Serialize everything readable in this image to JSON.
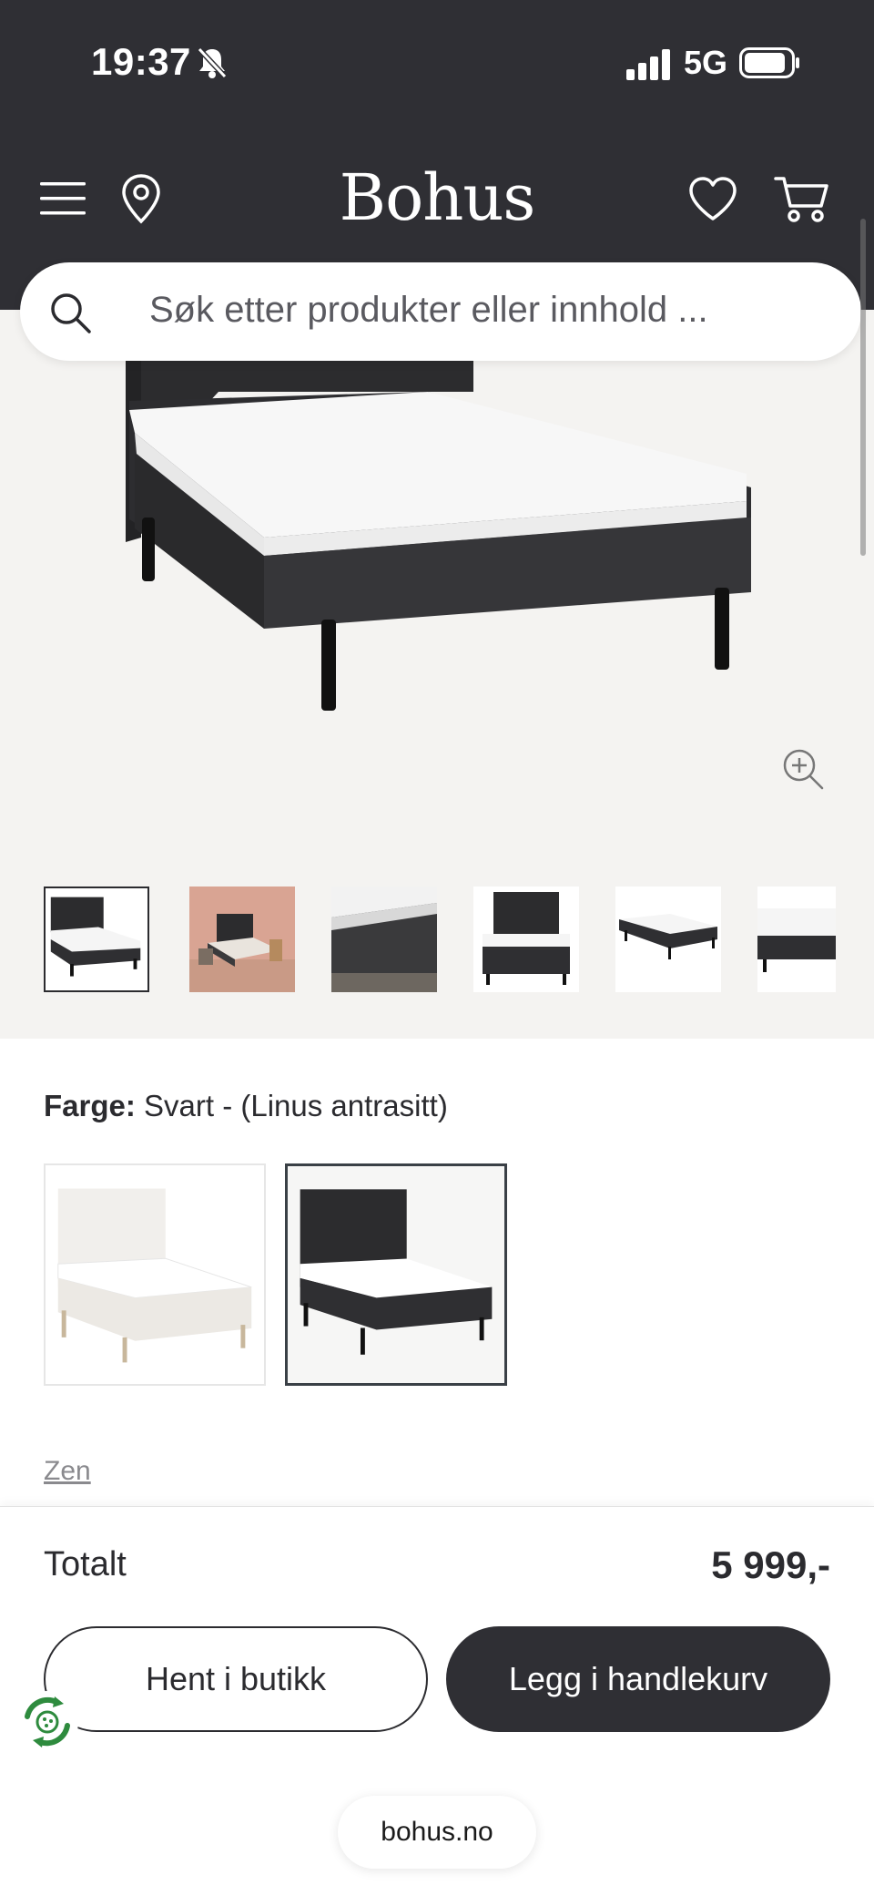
{
  "status_bar": {
    "time": "19:37",
    "network": "5G",
    "icons": [
      "bell-slash-icon",
      "signal-icon",
      "battery-icon"
    ]
  },
  "header": {
    "logo": "Bohus",
    "icons": [
      "menu-icon",
      "location-pin-icon",
      "heart-icon",
      "cart-icon"
    ]
  },
  "search": {
    "placeholder": "Søk etter produkter eller innhold ...",
    "icon": "search-icon"
  },
  "gallery": {
    "zoom_icon": "zoom-in-icon",
    "thumbnail_count_visible": 6,
    "selected_index": 0
  },
  "color": {
    "label": "Farge:",
    "value": "Svart - (Linus antrasitt)",
    "options": [
      "white-bed-swatch",
      "black-bed-swatch"
    ],
    "selected_index": 1
  },
  "series_link": "Zen",
  "checkout": {
    "total_label": "Totalt",
    "total_price": "5 999,-",
    "pickup_button": "Hent i butikk",
    "add_to_cart_button": "Legg i handlekurv"
  },
  "browser": {
    "url": "bohus.no"
  },
  "colors": {
    "header_bg": "#2f2f34",
    "hero_bg": "#f4f3f1",
    "text": "#2b2b2f",
    "eco_green": "#2e8b3e"
  }
}
